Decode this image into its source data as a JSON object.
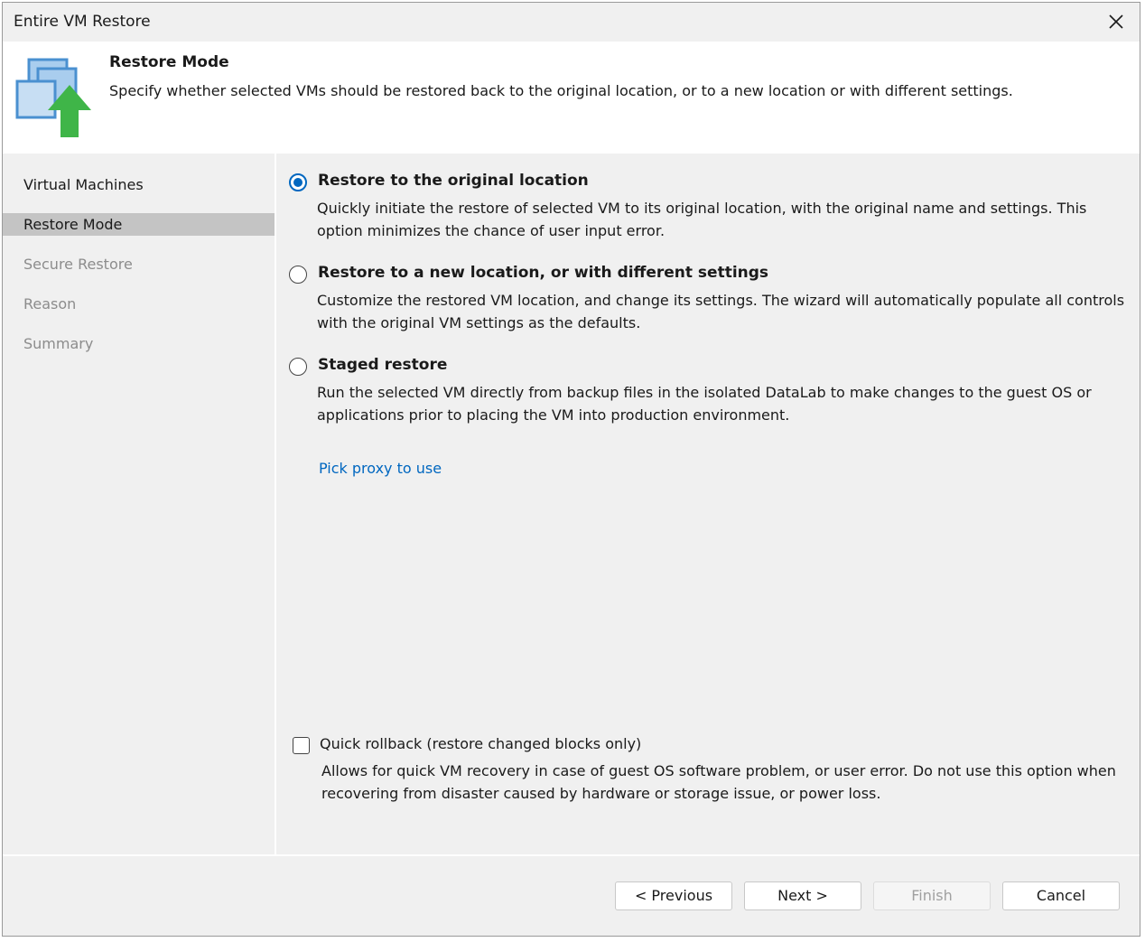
{
  "window": {
    "title": "Entire VM Restore"
  },
  "header": {
    "title": "Restore Mode",
    "description": "Specify whether selected VMs should be restored back to the original location, or to a new location or with different settings."
  },
  "sidebar": {
    "items": [
      {
        "label": "Virtual Machines",
        "state": "normal"
      },
      {
        "label": "Restore Mode",
        "state": "active"
      },
      {
        "label": "Secure Restore",
        "state": "disabled"
      },
      {
        "label": "Reason",
        "state": "disabled"
      },
      {
        "label": "Summary",
        "state": "disabled"
      }
    ]
  },
  "options": [
    {
      "label": "Restore to the original location",
      "checked": true,
      "description": "Quickly initiate the restore of selected VM to its original location, with the original name and settings. This option minimizes the chance of user input error."
    },
    {
      "label": "Restore to a new location, or with different settings",
      "checked": false,
      "description": "Customize the restored VM location, and change its settings. The wizard will automatically populate all controls with the original VM settings as the defaults."
    },
    {
      "label": "Staged restore",
      "checked": false,
      "description": "Run the selected VM directly from backup files in the isolated DataLab to make changes to the guest OS or applications prior to placing the VM into production environment."
    }
  ],
  "proxy_link": "Pick proxy to use",
  "quick_rollback": {
    "label": "Quick rollback (restore changed blocks only)",
    "checked": false,
    "description": "Allows for quick VM recovery in case of guest OS software problem, or user error. Do not use this option when recovering from disaster caused by hardware or storage issue, or power loss."
  },
  "buttons": {
    "previous": "< Previous",
    "next": "Next >",
    "finish": "Finish",
    "cancel": "Cancel"
  },
  "colors": {
    "accent": "#0067c0",
    "active_nav": "#c4c4c4",
    "disabled_text": "#8c8c8c",
    "icon_green": "#3fb548",
    "icon_blue": "#5aa0d8"
  }
}
